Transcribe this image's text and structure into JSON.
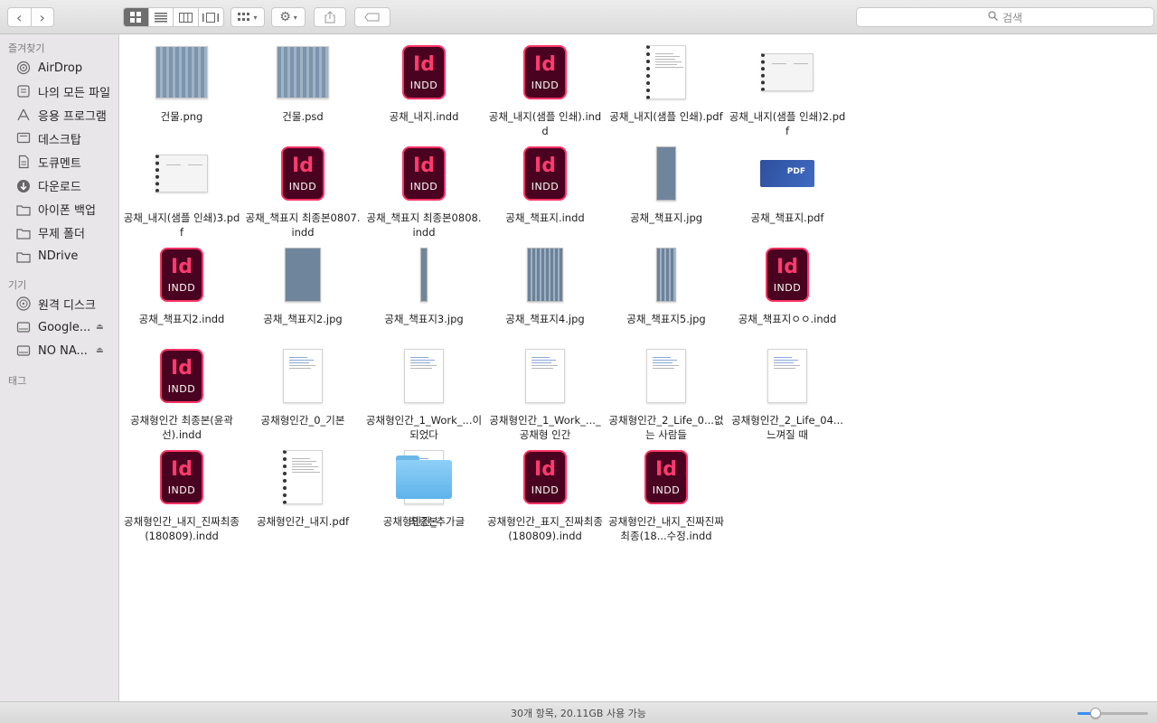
{
  "toolbar": {
    "back_icon": "chevron-left-icon",
    "forward_icon": "chevron-right-icon",
    "view_modes": [
      "icon-view-icon",
      "list-view-icon",
      "column-view-icon",
      "gallery-view-icon"
    ],
    "active_view": 0,
    "search_placeholder": "검색"
  },
  "sidebar": {
    "favorites_label": "즐겨찾기",
    "favorites": [
      {
        "label": "AirDrop",
        "icon": "airdrop-icon"
      },
      {
        "label": "나의 모든 파일",
        "icon": "all-files-icon"
      },
      {
        "label": "응용 프로그램",
        "icon": "applications-icon"
      },
      {
        "label": "데스크탑",
        "icon": "desktop-icon"
      },
      {
        "label": "도큐멘트",
        "icon": "documents-icon"
      },
      {
        "label": "다운로드",
        "icon": "downloads-icon"
      },
      {
        "label": "아이폰 백업",
        "icon": "folder-icon"
      },
      {
        "label": "무제 폴더",
        "icon": "folder-icon"
      },
      {
        "label": "NDrive",
        "icon": "folder-icon"
      }
    ],
    "devices_label": "기기",
    "devices": [
      {
        "label": "원격 디스크",
        "icon": "remote-disc-icon",
        "eject": false
      },
      {
        "label": "Google...",
        "icon": "drive-icon",
        "eject": true
      },
      {
        "label": "NO NA...",
        "icon": "drive-icon",
        "eject": true
      }
    ],
    "tags_label": "태그"
  },
  "files": [
    {
      "name": "건물.png",
      "kind": "img"
    },
    {
      "name": "건물.psd",
      "kind": "img"
    },
    {
      "name": "공채_내지.indd",
      "kind": "indd"
    },
    {
      "name": "공채_내지(샘플 인쇄).indd",
      "kind": "indd"
    },
    {
      "name": "공채_내지(샘플 인쇄).pdf",
      "kind": "docring"
    },
    {
      "name": "공채_내지(샘플 인쇄)2.pdf",
      "kind": "docland"
    },
    {
      "name": "공채_내지(샘플 인쇄)3.pdf",
      "kind": "docland"
    },
    {
      "name": "공채_책표지 최종본0807.indd",
      "kind": "indd"
    },
    {
      "name": "공채_책표지 최종본0808.indd",
      "kind": "indd"
    },
    {
      "name": "공채_책표지.indd",
      "kind": "indd"
    },
    {
      "name": "공채_책표지.jpg",
      "kind": "tall"
    },
    {
      "name": "공채_책표지.pdf",
      "kind": "pdfland"
    },
    {
      "name": "공채_책표지2.indd",
      "kind": "indd"
    },
    {
      "name": "공채_책표지2.jpg",
      "kind": "cover"
    },
    {
      "name": "공채_책표지3.jpg",
      "kind": "spine"
    },
    {
      "name": "공채_책표지4.jpg",
      "kind": "cover2"
    },
    {
      "name": "공채_책표지5.jpg",
      "kind": "tall2"
    },
    {
      "name": "공채_책표지ㅇㅇ.indd",
      "kind": "indd"
    },
    {
      "name": "공채형인간 최종본(윤곽선).indd",
      "kind": "indd"
    },
    {
      "name": "공채형인간_0_기본",
      "kind": "doc"
    },
    {
      "name": "공채형인간_1_Work_...이 되었다",
      "kind": "doc"
    },
    {
      "name": "공채형인간_1_Work_..._공채형 인간",
      "kind": "doc"
    },
    {
      "name": "공채형인간_2_Life_0...없는 사람들",
      "kind": "doc"
    },
    {
      "name": "공채형인간_2_Life_04...느껴질 때",
      "kind": "doc"
    },
    {
      "name": "공채형인간_내지_진짜최종(180809).indd",
      "kind": "indd"
    },
    {
      "name": "공채형인간_내지.pdf",
      "kind": "docring"
    },
    {
      "name": "공채형인간_추가글",
      "kind": "doc"
    },
    {
      "name": "공채형인간_표지_진짜최종(180809).indd",
      "kind": "indd"
    },
    {
      "name": "공채형인간_내지_진짜진짜최종(18...수정.indd",
      "kind": "indd"
    },
    {
      "name": "최종본",
      "kind": "folder"
    }
  ],
  "indd_icon": {
    "glyph": "Id",
    "caption": "INDD"
  },
  "pdf_badge": "PDF",
  "status": {
    "text": "30개 항목, 20.11GB 사용 가능",
    "zoom_fraction": 0.25
  }
}
